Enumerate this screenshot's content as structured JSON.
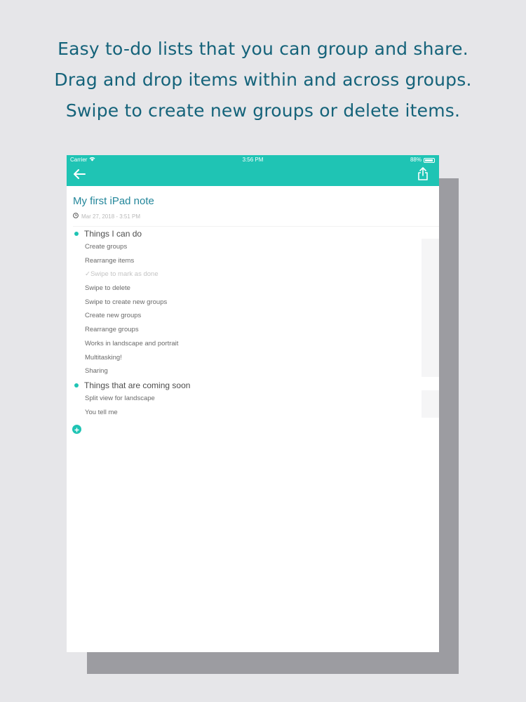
{
  "headline": {
    "line1": "Easy to-do lists that you can group and share.",
    "line2": "Drag and drop items within and across groups.",
    "line3": "Swipe to create new groups or delete items."
  },
  "status_bar": {
    "carrier": "Carrier",
    "time": "3:56 PM",
    "battery": "88%",
    "battery_level": 0.88
  },
  "colors": {
    "accent": "#1fc4b4",
    "title": "#23869a",
    "headline": "#15637a"
  },
  "nav": {
    "back_icon": "arrow-left-icon",
    "share_icon": "share-icon"
  },
  "note": {
    "title": "My first iPad note",
    "timestamp": "Mar 27, 2018 - 3:51 PM"
  },
  "groups": [
    {
      "title": "Things I can do",
      "items": [
        {
          "label": "Create groups",
          "done": false
        },
        {
          "label": "Rearrange items",
          "done": false
        },
        {
          "label": "Swipe to mark as done",
          "done": true
        },
        {
          "label": "Swipe to delete",
          "done": false
        },
        {
          "label": "Swipe to create new groups",
          "done": false
        },
        {
          "label": "Create new groups",
          "done": false
        },
        {
          "label": "Rearrange groups",
          "done": false
        },
        {
          "label": "Works in landscape and portrait",
          "done": false
        },
        {
          "label": "Multitasking!",
          "done": false
        },
        {
          "label": "Sharing",
          "done": false
        }
      ]
    },
    {
      "title": "Things that are coming soon",
      "items": [
        {
          "label": "Split view for landscape",
          "done": false
        },
        {
          "label": "You tell me",
          "done": false
        }
      ]
    }
  ],
  "add_button_icon": "plus-circle-icon"
}
